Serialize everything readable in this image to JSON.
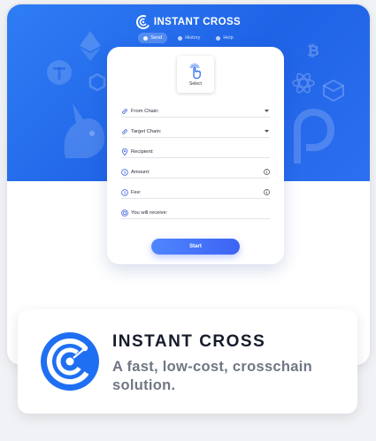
{
  "app": {
    "title": "INSTANT CROSS"
  },
  "nav": {
    "tabs": [
      {
        "label": "Send"
      },
      {
        "label": "History"
      },
      {
        "label": "Help"
      }
    ]
  },
  "form": {
    "select_label": "Select",
    "from_chain": "From Chain:",
    "target_chain": "Target Chain:",
    "recipient": "Recipient:",
    "amount": "Amount:",
    "fee": "Fee:",
    "receive": "You will receive:",
    "start_button": "Start"
  },
  "banner": {
    "title": "INSTANT CROSS",
    "subtitle": "A fast, low-cost, crosschain solution."
  },
  "colors": {
    "accent": "#2f7df5",
    "button": "#4a74f8",
    "banner_title": "#151b2a",
    "banner_sub": "#707784"
  }
}
